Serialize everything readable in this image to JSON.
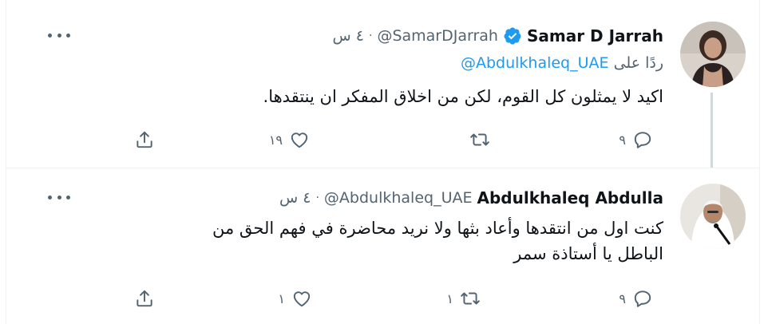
{
  "tweets": [
    {
      "name": "Samar D Jarrah",
      "verified": true,
      "handle": "@SamarDJarrah",
      "separator": "·",
      "time": "٤ س",
      "reply_prefix": "ردًا على",
      "reply_mention": "@Abdulkhaleq_UAE",
      "text": "اكيد لا يمثلون كل القوم، لكن من اخلاق المفكر ان ينتقدها.",
      "replies": "٩",
      "retweets": "",
      "likes": "١٩"
    },
    {
      "name": "Abdulkhaleq Abdulla",
      "verified": false,
      "handle": "@Abdulkhaleq_UAE",
      "separator": "·",
      "time": "٤ س",
      "text_line1": "كنت اول من انتقدها وأعاد بثها ولا نريد محاضرة في فهم الحق من",
      "text_line2": "الباطل يا أستاذة سمر",
      "replies": "٩",
      "retweets": "١",
      "likes": "١"
    }
  ],
  "icons": {
    "verified": "verified-badge-icon",
    "more": "more-options-icon",
    "reply": "reply-icon",
    "retweet": "retweet-icon",
    "like": "heart-icon",
    "share": "share-icon"
  },
  "colors": {
    "accent": "#1d9bf0",
    "secondary_text": "#536471",
    "primary_text": "#0f1419"
  }
}
